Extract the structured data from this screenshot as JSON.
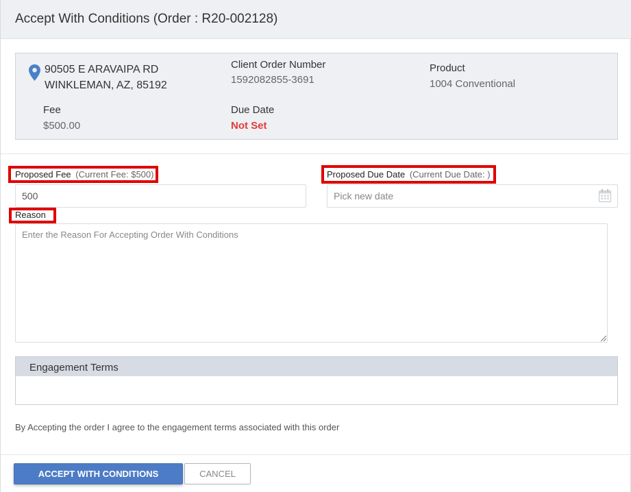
{
  "modal": {
    "title": "Accept With Conditions (Order : R20-002128)"
  },
  "order_info": {
    "address_line1": "90505 E ARAVAIPA RD",
    "address_line2": "WINKLEMAN, AZ, 85192",
    "client_order_number_label": "Client Order Number",
    "client_order_number_value": "1592082855-3691",
    "product_label": "Product",
    "product_value": "1004 Conventional",
    "fee_label": "Fee",
    "fee_value": "$500.00",
    "due_date_label": "Due Date",
    "due_date_value": "Not Set",
    "icons": {
      "location": "map-pin-icon"
    },
    "colors": {
      "not_set": "#e53a3a"
    }
  },
  "form": {
    "proposed_fee_label": "Proposed Fee",
    "proposed_fee_hint": "(Current Fee: $500)",
    "proposed_fee_value": "500",
    "proposed_due_date_label": "Proposed Due Date",
    "proposed_due_date_hint": "(Current Due Date: )",
    "proposed_due_date_placeholder": "Pick new date",
    "reason_label": "Reason",
    "reason_placeholder": "Enter the Reason For Accepting Order With Conditions",
    "icons": {
      "date_picker": "calendar-icon"
    }
  },
  "engagement_terms": {
    "title": "Engagement Terms",
    "agreement_text": "By Accepting the order I agree to the engagement terms associated with this order"
  },
  "actions": {
    "accept_label": "ACCEPT WITH CONDITIONS",
    "cancel_label": "CANCEL",
    "colors": {
      "primary": "#4d7cc6",
      "highlight_box": "#e00000"
    }
  }
}
